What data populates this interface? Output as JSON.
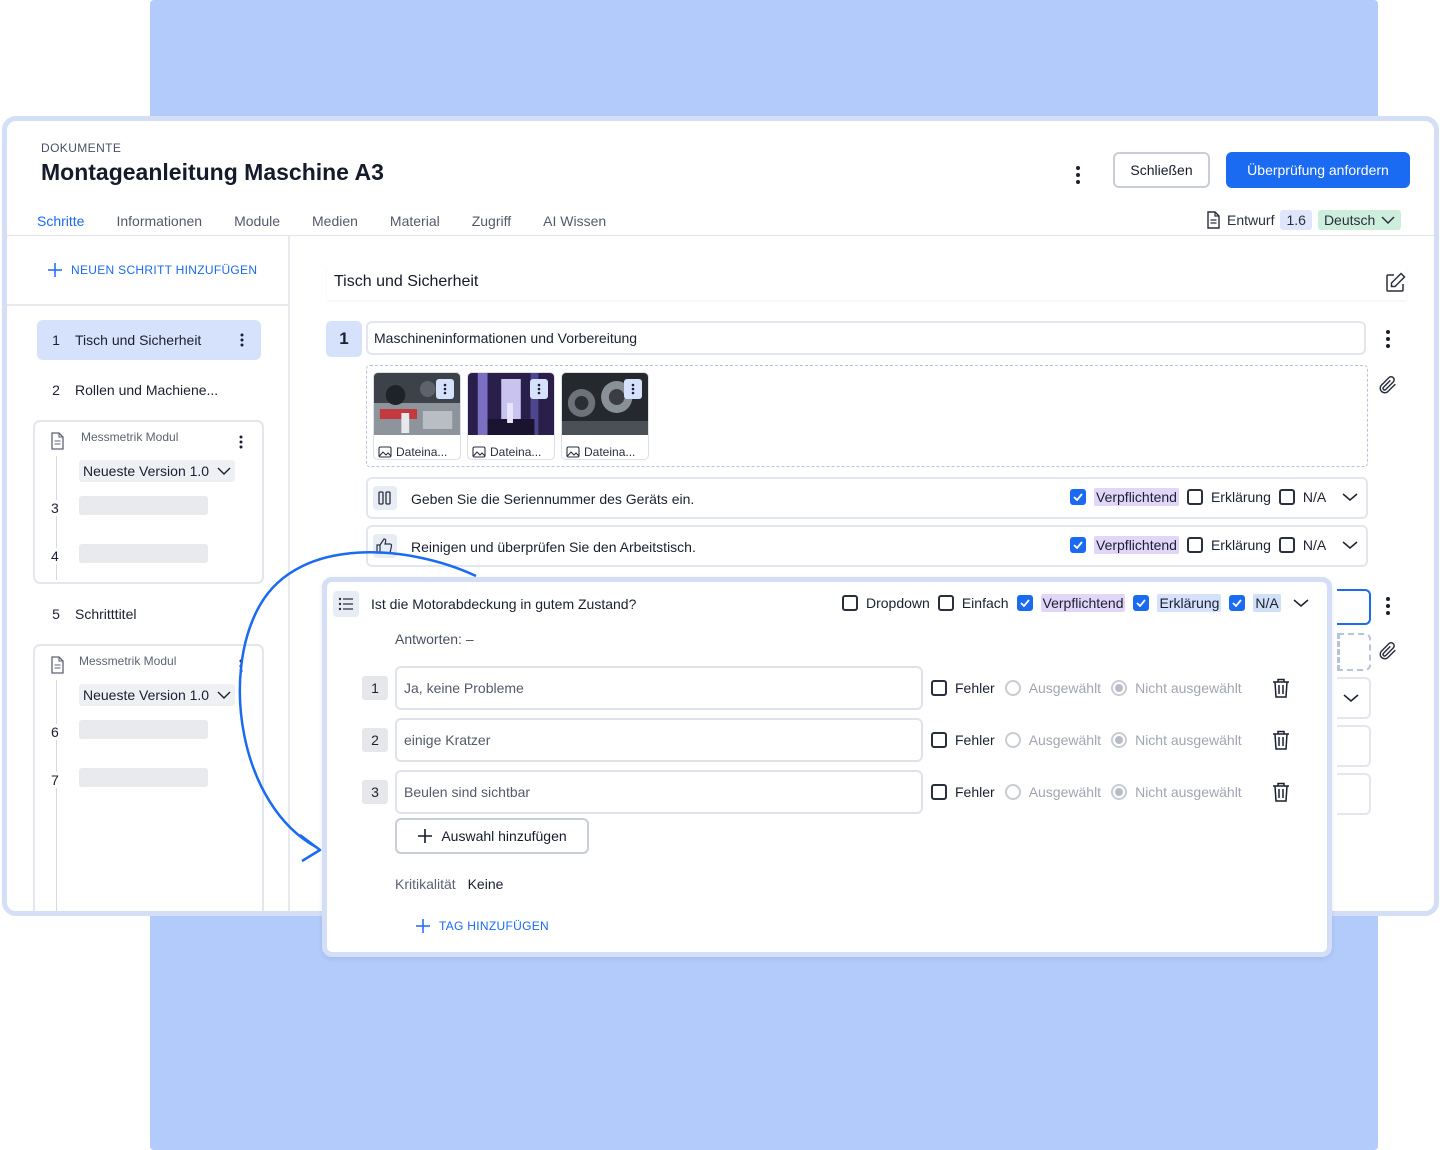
{
  "header": {
    "breadcrumb": "DOKUMENTE",
    "title": "Montageanleitung Maschine A3",
    "close_label": "Schließen",
    "review_label": "Überprüfung anfordern"
  },
  "tabs": [
    "Schritte",
    "Informationen",
    "Module",
    "Medien",
    "Material",
    "Zugriff",
    "AI Wissen"
  ],
  "status": {
    "state": "Entwurf",
    "version": "1.6",
    "language": "Deutsch"
  },
  "sidebar": {
    "add_step_label": "NEUEN SCHRITT HINZUFÜGEN",
    "steps": [
      {
        "num": "1",
        "label": "Tisch und Sicherheit"
      },
      {
        "num": "2",
        "label": "Rollen und Machiene..."
      },
      {
        "num": "5",
        "label": "Schritttitel"
      }
    ],
    "modules": [
      {
        "label": "Messmetrik Modul",
        "version": "Neueste Version 1.0",
        "subs": [
          "3",
          "4"
        ]
      },
      {
        "label": "Messmetrik Modul",
        "version": "Neueste Version 1.0",
        "subs": [
          "6",
          "7"
        ]
      }
    ]
  },
  "main": {
    "step_title": "Tisch und Sicherheit",
    "block_num": "1",
    "block_title": "Maschineninformationen und Vorbereitung",
    "media": [
      {
        "caption": "Dateina..."
      },
      {
        "caption": "Dateina..."
      },
      {
        "caption": "Dateina..."
      }
    ],
    "items": [
      {
        "text": "Geben Sie die Seriennummer des Geräts ein.",
        "required": "Verpflichtend",
        "explain": "Erklärung",
        "na": "N/A"
      },
      {
        "text": "Reinigen und überprüfen Sie den Arbeitstisch.",
        "required": "Verpflichtend",
        "explain": "Erklärung",
        "na": "N/A"
      }
    ]
  },
  "question": {
    "title": "Ist die Motorabdeckung in gutem Zustand?",
    "options": {
      "dropdown": "Dropdown",
      "simple": "Einfach",
      "required": "Verpflichtend",
      "explain": "Erklärung",
      "na": "N/A"
    },
    "answers_label": "Antworten:  –",
    "answers": [
      {
        "num": "1",
        "text": "Ja, keine Probleme"
      },
      {
        "num": "2",
        "text": "einige Kratzer"
      },
      {
        "num": "3",
        "text": "Beulen sind sichtbar"
      }
    ],
    "error_label": "Fehler",
    "selected_label": "Ausgewählt",
    "not_selected_label": "Nicht ausgewählt",
    "add_choice_label": "Auswahl hinzufügen",
    "criticality_label": "Kritikalität",
    "criticality_value": "Keine",
    "add_tag_label": "TAG HINZUFÜGEN"
  },
  "colors": {
    "accent": "#1a6af2",
    "backdrop": "#b2cbfb",
    "selection": "#d6e1fb"
  }
}
